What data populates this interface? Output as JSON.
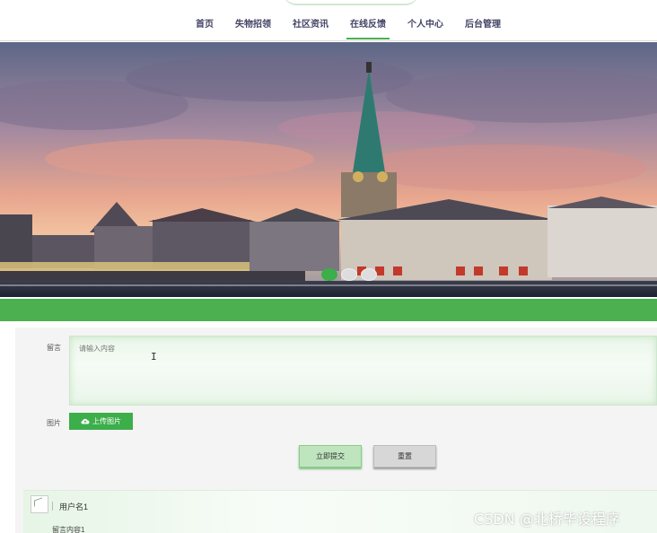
{
  "nav": {
    "items": [
      {
        "label": "首页"
      },
      {
        "label": "失物招领"
      },
      {
        "label": "社区资讯"
      },
      {
        "label": "在线反馈",
        "active": true
      },
      {
        "label": "个人中心"
      },
      {
        "label": "后台管理"
      }
    ],
    "accent_color": "#4caf50"
  },
  "banner": {
    "image": "city-church-sunset-photo",
    "slides": 3,
    "active_slide": 1
  },
  "form": {
    "message_label": "留言",
    "message_placeholder": "请输入内容",
    "image_label": "图片",
    "upload_label": "上传图片",
    "upload_icon": "cloud-upload-icon",
    "submit_label": "立即提交",
    "reset_label": "重置"
  },
  "comments": [
    {
      "username": "用户名1",
      "content": "留言内容1"
    }
  ],
  "watermark": "CSDN @北桥毕设程序"
}
